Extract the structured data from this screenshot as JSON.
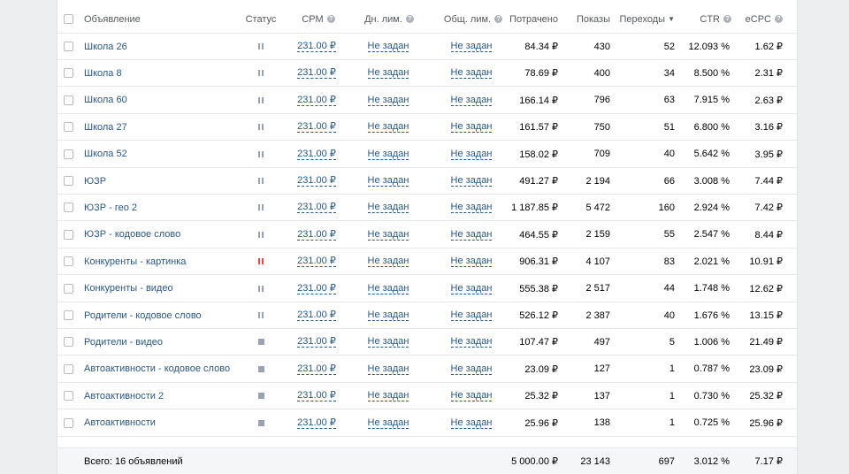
{
  "header": {
    "ad": "Объявление",
    "status": "Статус",
    "cpm": "CPM",
    "daily_limit": "Дн. лим.",
    "total_limit": "Общ. лим.",
    "spent": "Потрачено",
    "impressions": "Показы",
    "clicks": "Переходы",
    "clicks_sort_icon": "arrow-down-icon",
    "ctr": "CTR",
    "ecpc": "eCPC",
    "help_glyph": "?"
  },
  "rows": [
    {
      "name": "Школа 26",
      "status": "paused",
      "cpm": "231.00 ₽",
      "daily": "Не задан",
      "total": "Не задан",
      "spent": "84.34 ₽",
      "impressions": "430",
      "clicks": "52",
      "ctr": "12.093 %",
      "ecpc": "1.62 ₽"
    },
    {
      "name": "Школа 8",
      "status": "paused",
      "cpm": "231.00 ₽",
      "daily": "Не задан",
      "total": "Не задан",
      "spent": "78.69 ₽",
      "impressions": "400",
      "clicks": "34",
      "ctr": "8.500 %",
      "ecpc": "2.31 ₽"
    },
    {
      "name": "Школа 60",
      "status": "paused",
      "cpm": "231.00 ₽",
      "daily": "Не задан",
      "total": "Не задан",
      "spent": "166.14 ₽",
      "impressions": "796",
      "clicks": "63",
      "ctr": "7.915 %",
      "ecpc": "2.63 ₽"
    },
    {
      "name": "Школа 27",
      "status": "paused",
      "cpm": "231.00 ₽",
      "daily": "Не задан",
      "total": "Не задан",
      "spent": "161.57 ₽",
      "impressions": "750",
      "clicks": "51",
      "ctr": "6.800 %",
      "ecpc": "3.16 ₽"
    },
    {
      "name": "Школа 52",
      "status": "paused",
      "cpm": "231.00 ₽",
      "daily": "Не задан",
      "total": "Не задан",
      "spent": "158.02 ₽",
      "impressions": "709",
      "clicks": "40",
      "ctr": "5.642 %",
      "ecpc": "3.95 ₽"
    },
    {
      "name": "ЮЗР",
      "status": "paused",
      "cpm": "231.00 ₽",
      "daily": "Не задан",
      "total": "Не задан",
      "spent": "491.27 ₽",
      "impressions": "2 194",
      "clicks": "66",
      "ctr": "3.008 %",
      "ecpc": "7.44 ₽"
    },
    {
      "name": "ЮЗР - гео 2",
      "status": "paused",
      "cpm": "231.00 ₽",
      "daily": "Не задан",
      "total": "Не задан",
      "spent": "1 187.85 ₽",
      "impressions": "5 472",
      "clicks": "160",
      "ctr": "2.924 %",
      "ecpc": "7.42 ₽"
    },
    {
      "name": "ЮЗР - кодовое слово",
      "status": "paused",
      "cpm": "231.00 ₽",
      "daily": "Не задан",
      "total": "Не задан",
      "spent": "464.55 ₽",
      "impressions": "2 159",
      "clicks": "55",
      "ctr": "2.547 %",
      "ecpc": "8.44 ₽"
    },
    {
      "name": "Конкуренты - картинка",
      "status": "paused-red",
      "cpm": "231.00 ₽",
      "daily": "Не задан",
      "total": "Не задан",
      "spent": "906.31 ₽",
      "impressions": "4 107",
      "clicks": "83",
      "ctr": "2.021 %",
      "ecpc": "10.91 ₽"
    },
    {
      "name": "Конкуренты - видео",
      "status": "paused",
      "cpm": "231.00 ₽",
      "daily": "Не задан",
      "total": "Не задан",
      "spent": "555.38 ₽",
      "impressions": "2 517",
      "clicks": "44",
      "ctr": "1.748 %",
      "ecpc": "12.62 ₽"
    },
    {
      "name": "Родители - кодовое слово",
      "status": "paused",
      "cpm": "231.00 ₽",
      "daily": "Не задан",
      "total": "Не задан",
      "spent": "526.12 ₽",
      "impressions": "2 387",
      "clicks": "40",
      "ctr": "1.676 %",
      "ecpc": "13.15 ₽"
    },
    {
      "name": "Родители - видео",
      "status": "stopped",
      "cpm": "231.00 ₽",
      "daily": "Не задан",
      "total": "Не задан",
      "spent": "107.47 ₽",
      "impressions": "497",
      "clicks": "5",
      "ctr": "1.006 %",
      "ecpc": "21.49 ₽"
    },
    {
      "name": "Автоактивности - кодовое слово",
      "status": "stopped",
      "cpm": "231.00 ₽",
      "daily": "Не задан",
      "total": "Не задан",
      "spent": "23.09 ₽",
      "impressions": "127",
      "clicks": "1",
      "ctr": "0.787 %",
      "ecpc": "23.09 ₽"
    },
    {
      "name": "Автоактивности 2",
      "status": "stopped",
      "cpm": "231.00 ₽",
      "daily": "Не задан",
      "total": "Не задан",
      "spent": "25.32 ₽",
      "impressions": "137",
      "clicks": "1",
      "ctr": "0.730 %",
      "ecpc": "25.32 ₽"
    },
    {
      "name": "Автоактивности",
      "status": "stopped",
      "cpm": "231.00 ₽",
      "daily": "Не задан",
      "total": "Не задан",
      "spent": "25.96 ₽",
      "impressions": "138",
      "clicks": "1",
      "ctr": "0.725 %",
      "ecpc": "25.96 ₽"
    }
  ],
  "footer": {
    "total_label": "Всего: 16 объявлений",
    "spent": "5 000.00 ₽",
    "impressions": "23 143",
    "clicks": "697",
    "ctr": "3.012 %",
    "ecpc": "7.17 ₽"
  },
  "colors": {
    "link": "#2a5885",
    "status_paused": "#99a2ad",
    "status_alert": "#e64646"
  }
}
